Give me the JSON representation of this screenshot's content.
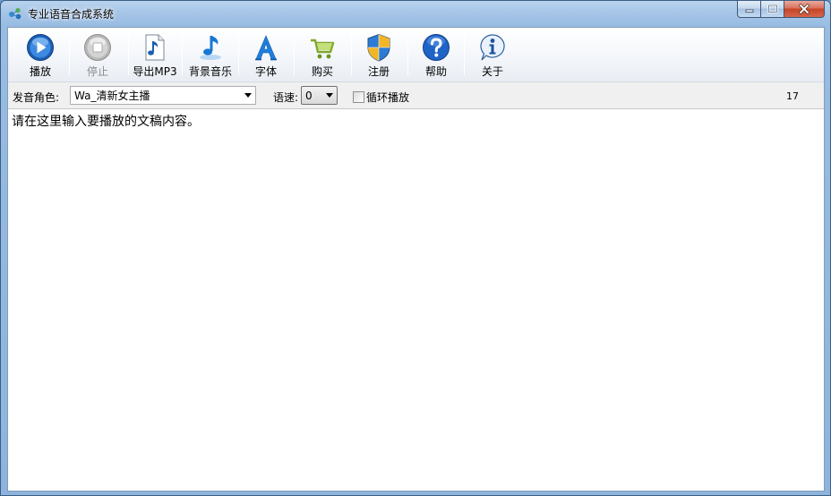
{
  "window": {
    "title": "专业语音合成系统"
  },
  "toolbar": {
    "buttons": [
      {
        "id": "play",
        "label": "播放",
        "icon": "play-icon",
        "enabled": true
      },
      {
        "id": "stop",
        "label": "停止",
        "icon": "stop-icon",
        "enabled": false
      },
      {
        "id": "export",
        "label": "导出MP3",
        "icon": "music-note-icon",
        "enabled": true
      },
      {
        "id": "bgm",
        "label": "背景音乐",
        "icon": "music-note-blue-icon",
        "enabled": true
      },
      {
        "id": "font",
        "label": "字体",
        "icon": "font-a-icon",
        "enabled": true
      },
      {
        "id": "buy",
        "label": "购买",
        "icon": "shopping-cart-icon",
        "enabled": true
      },
      {
        "id": "register",
        "label": "注册",
        "icon": "shield-icon",
        "enabled": true
      },
      {
        "id": "help",
        "label": "帮助",
        "icon": "help-question-icon",
        "enabled": true
      },
      {
        "id": "about",
        "label": "关于",
        "icon": "info-icon",
        "enabled": true
      }
    ]
  },
  "options": {
    "voice_label": "发音角色:",
    "voice_value": "Wa_清新女主播",
    "speed_label": "语速:",
    "speed_value": "0",
    "loop_label": "循环播放",
    "loop_checked": false,
    "char_count": "17"
  },
  "editor": {
    "text": "请在这里输入要播放的文稿内容。"
  },
  "colors": {
    "accent_blue": "#1e6fc8",
    "titlebar": "#a7c6e7",
    "close_red": "#c74326"
  }
}
